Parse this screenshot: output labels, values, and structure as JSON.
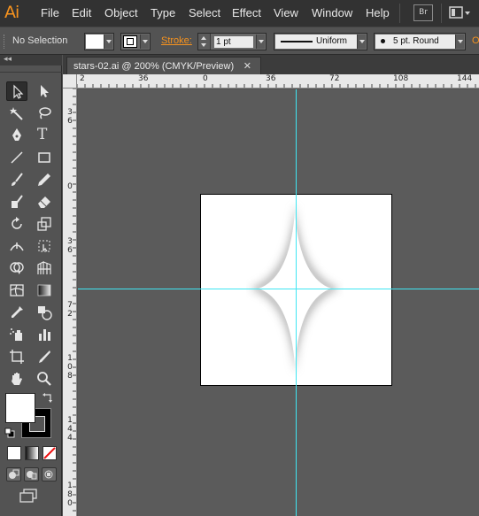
{
  "app": {
    "logo": "Ai"
  },
  "menu": [
    "File",
    "Edit",
    "Object",
    "Type",
    "Select",
    "Effect",
    "View",
    "Window",
    "Help"
  ],
  "bridge_button": "Br",
  "control_bar": {
    "selection_status": "No Selection",
    "stroke_label": "Stroke:",
    "stroke_weight": "1 pt",
    "variable_width_profile": "Uniform",
    "brush_definition": "5 pt. Round",
    "opacity_label": "O"
  },
  "toolbar": {
    "collapse_label": "◂◂"
  },
  "document_tab": {
    "title": "stars-02.ai @ 200% (CMYK/Preview)",
    "close": "✕"
  },
  "ruler_h_labels": [
    "2",
    "36",
    "0",
    "36",
    "72",
    "108",
    "144"
  ],
  "ruler_v_labels": [
    "36",
    "0",
    "36",
    "72",
    "108",
    "144",
    "180"
  ],
  "colors": {
    "guide": "#3fe6f2",
    "accent": "#f7931e",
    "canvas": "#5b5b5b",
    "ui": "#535353"
  }
}
